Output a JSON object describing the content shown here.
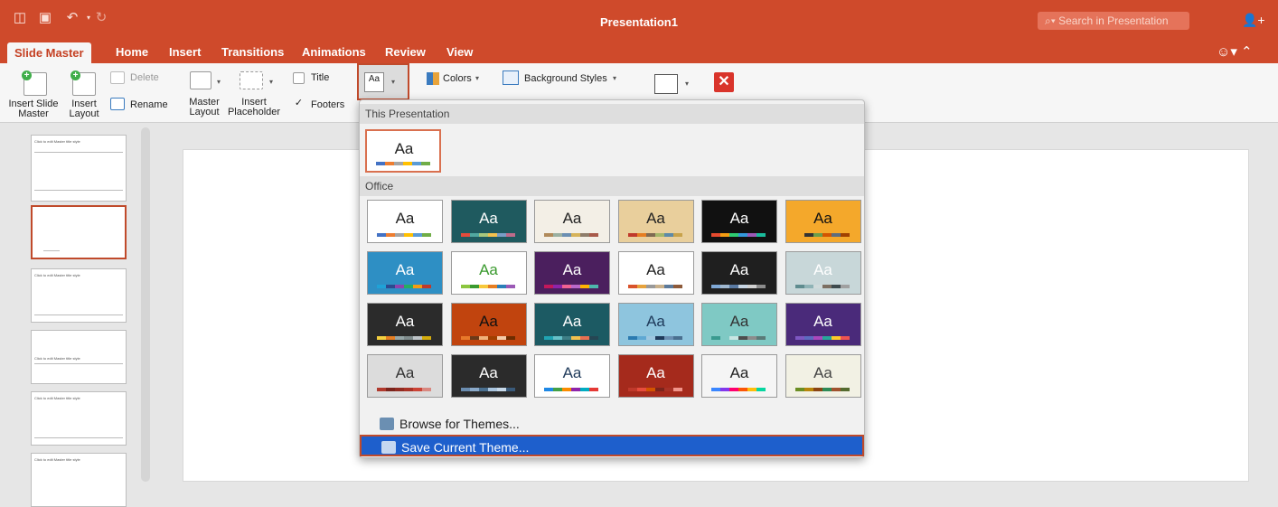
{
  "window": {
    "title": "Presentation1",
    "search_placeholder": "Search in Presentation",
    "quick_access": [
      "sidebar-icon",
      "save-icon",
      "undo-icon",
      "redo-icon"
    ]
  },
  "tabs": [
    "Slide Master",
    "Home",
    "Insert",
    "Transitions",
    "Animations",
    "Review",
    "View"
  ],
  "ribbon": {
    "insert_slide_master": "Insert Slide\nMaster",
    "insert_layout": "Insert\nLayout",
    "delete": "Delete",
    "rename": "Rename",
    "master_layout": "Master\nLayout",
    "insert_placeholder": "Insert\nPlaceholder",
    "title_cb": "Title",
    "footers_cb": "Footers",
    "themes_btn": "Aa",
    "colors": "Colors",
    "background_styles": "Background Styles"
  },
  "sidebar": {
    "thumb1_title": "Click to edit Master title style",
    "thumb3_title": "Click to edit Master title style",
    "thumb4_title": "Click to edit Master title style",
    "thumb5_title": "Click to edit Master title style",
    "thumb6_title": "Click to edit Master title style"
  },
  "theme_menu": {
    "this_presentation_label": "This Presentation",
    "office_label": "Office",
    "browse": "Browse for Themes...",
    "save": "Save Current Theme...",
    "current_theme": {
      "aa": "Aa",
      "bg": "#ffffff",
      "fg": "#222222",
      "colors": [
        "#4472c4",
        "#ed7d31",
        "#a5a5a5",
        "#ffc000",
        "#5b9bd5",
        "#70ad47"
      ]
    },
    "themes": [
      {
        "aa": "Aa",
        "bg": "#ffffff",
        "fg": "#222222",
        "colors": [
          "#4472c4",
          "#ed7d31",
          "#a5a5a5",
          "#ffc000",
          "#5b9bd5",
          "#70ad47"
        ]
      },
      {
        "aa": "Aa",
        "bg": "#1f5a5f",
        "fg": "#ffffff",
        "colors": [
          "#e24b3b",
          "#51a8a0",
          "#a7c77d",
          "#f2c14e",
          "#7a9ec6",
          "#bf6b8b"
        ]
      },
      {
        "aa": "Aa",
        "bg": "#f3efe6",
        "fg": "#222222",
        "colors": [
          "#b08a5a",
          "#9ab0a1",
          "#6b8fb2",
          "#d6b35a",
          "#8e7d6b",
          "#a85a4a"
        ]
      },
      {
        "aa": "Aa",
        "bg": "#e9cf9c",
        "fg": "#222222",
        "colors": [
          "#c0392b",
          "#e67e22",
          "#7f6a52",
          "#a4b76a",
          "#5d8aa8",
          "#c8a24a"
        ]
      },
      {
        "aa": "Aa",
        "bg": "#111111",
        "fg": "#ffffff",
        "colors": [
          "#e64a2e",
          "#f39c12",
          "#2ecc71",
          "#3498db",
          "#9b59b6",
          "#1abc9c"
        ]
      },
      {
        "aa": "Aa",
        "bg": "#f4a82b",
        "fg": "#111111",
        "colors": [
          "#f4a82b",
          "#333333",
          "#6b9e4a",
          "#d35400",
          "#5d6d7e",
          "#a04000"
        ]
      },
      {
        "aa": "Aa",
        "bg": "#2e8fc4",
        "fg": "#ffffff",
        "colors": [
          "#1fa2d7",
          "#2e4a8f",
          "#8e44ad",
          "#27ae60",
          "#f39c12",
          "#c0392b"
        ]
      },
      {
        "aa": "Aa",
        "bg": "#ffffff",
        "fg": "#3a9a2e",
        "colors": [
          "#8cc63f",
          "#3a9a2e",
          "#f7c93b",
          "#e67e22",
          "#2c7fb8",
          "#9b59b6"
        ]
      },
      {
        "aa": "Aa",
        "bg": "#4b1f5e",
        "fg": "#ffffff",
        "colors": [
          "#c2185b",
          "#8e24aa",
          "#f06292",
          "#ba68c8",
          "#ffb300",
          "#4db6ac"
        ]
      },
      {
        "aa": "Aa",
        "bg": "#ffffff",
        "fg": "#222222",
        "colors": [
          "#d9532b",
          "#e6a23c",
          "#999999",
          "#c8b08b",
          "#5c7a9a",
          "#8e5a3a"
        ]
      },
      {
        "aa": "Aa",
        "bg": "#1f1f1f",
        "fg": "#ffffff",
        "colors": [
          "#7fa8d6",
          "#9fb7cf",
          "#5a7aa3",
          "#c6d4e3",
          "#d0d0d0",
          "#8c8c8c"
        ]
      },
      {
        "aa": "Aa",
        "bg": "#c8d7d9",
        "fg": "#ffffff",
        "colors": [
          "#5f8c8f",
          "#8fb3b6",
          "#cfdadb",
          "#7c6f62",
          "#3e4a4d",
          "#a0a0a0"
        ]
      },
      {
        "aa": "Aa",
        "bg": "#2b2b2b",
        "fg": "#ffffff",
        "colors": [
          "#f4d03f",
          "#e67e22",
          "#95a5a6",
          "#7f8c8d",
          "#bdc3c7",
          "#d4ac0d"
        ]
      },
      {
        "aa": "Aa",
        "bg": "#c1440e",
        "fg": "#111111",
        "colors": [
          "#e8792a",
          "#6b3a1a",
          "#f0b27a",
          "#a04000",
          "#f5cba7",
          "#6e2c00"
        ]
      },
      {
        "aa": "Aa",
        "bg": "#1c5a63",
        "fg": "#ffffff",
        "colors": [
          "#20a4b3",
          "#65c1c9",
          "#3e7f86",
          "#f2c14e",
          "#e76f51",
          "#264653"
        ]
      },
      {
        "aa": "Aa",
        "bg": "#8ec5de",
        "fg": "#1f3a5a",
        "colors": [
          "#2a7ab0",
          "#5fa8d3",
          "#9ec7e0",
          "#1f3a5a",
          "#6b8fb2",
          "#4a6f8f"
        ]
      },
      {
        "aa": "Aa",
        "bg": "#7fc9c4",
        "fg": "#333333",
        "colors": [
          "#3a9a8f",
          "#7fc9c4",
          "#c8e6e3",
          "#4d4d4d",
          "#8c8c8c",
          "#5a7a78"
        ]
      },
      {
        "aa": "Aa",
        "bg": "#4a2a7a",
        "fg": "#ffffff",
        "colors": [
          "#7e57c2",
          "#5c6bc0",
          "#ab47bc",
          "#26a69a",
          "#ffca28",
          "#ef5350"
        ]
      },
      {
        "aa": "Aa",
        "bg": "#dcdcdc",
        "fg": "#333333",
        "colors": [
          "#b03a2e",
          "#7b241c",
          "#922b21",
          "#a93226",
          "#cb4335",
          "#d98880"
        ]
      },
      {
        "aa": "Aa",
        "bg": "#2b2b2b",
        "fg": "#ffffff",
        "colors": [
          "#6a8caf",
          "#8aa9c9",
          "#4a6f8f",
          "#a9c4de",
          "#c7d9ea",
          "#3a5a7a"
        ]
      },
      {
        "aa": "Aa",
        "bg": "#ffffff",
        "fg": "#1f3a5a",
        "colors": [
          "#1e88e5",
          "#43a047",
          "#fb8c00",
          "#8e24aa",
          "#00acc1",
          "#e53935"
        ]
      },
      {
        "aa": "Aa",
        "bg": "#a52a1c",
        "fg": "#ffffff",
        "colors": [
          "#c0392b",
          "#e74c3c",
          "#d35400",
          "#7b241c",
          "#a93226",
          "#f1948a"
        ]
      },
      {
        "aa": "Aa",
        "bg": "#f5f5f5",
        "fg": "#222222",
        "colors": [
          "#3a86ff",
          "#8338ec",
          "#ff006e",
          "#fb5607",
          "#ffbe0b",
          "#06d6a0"
        ]
      },
      {
        "aa": "Aa",
        "bg": "#f2f1e4",
        "fg": "#444444",
        "colors": [
          "#6b8e23",
          "#b8860b",
          "#8b4513",
          "#2e8b57",
          "#a0522d",
          "#556b2f"
        ]
      }
    ]
  }
}
